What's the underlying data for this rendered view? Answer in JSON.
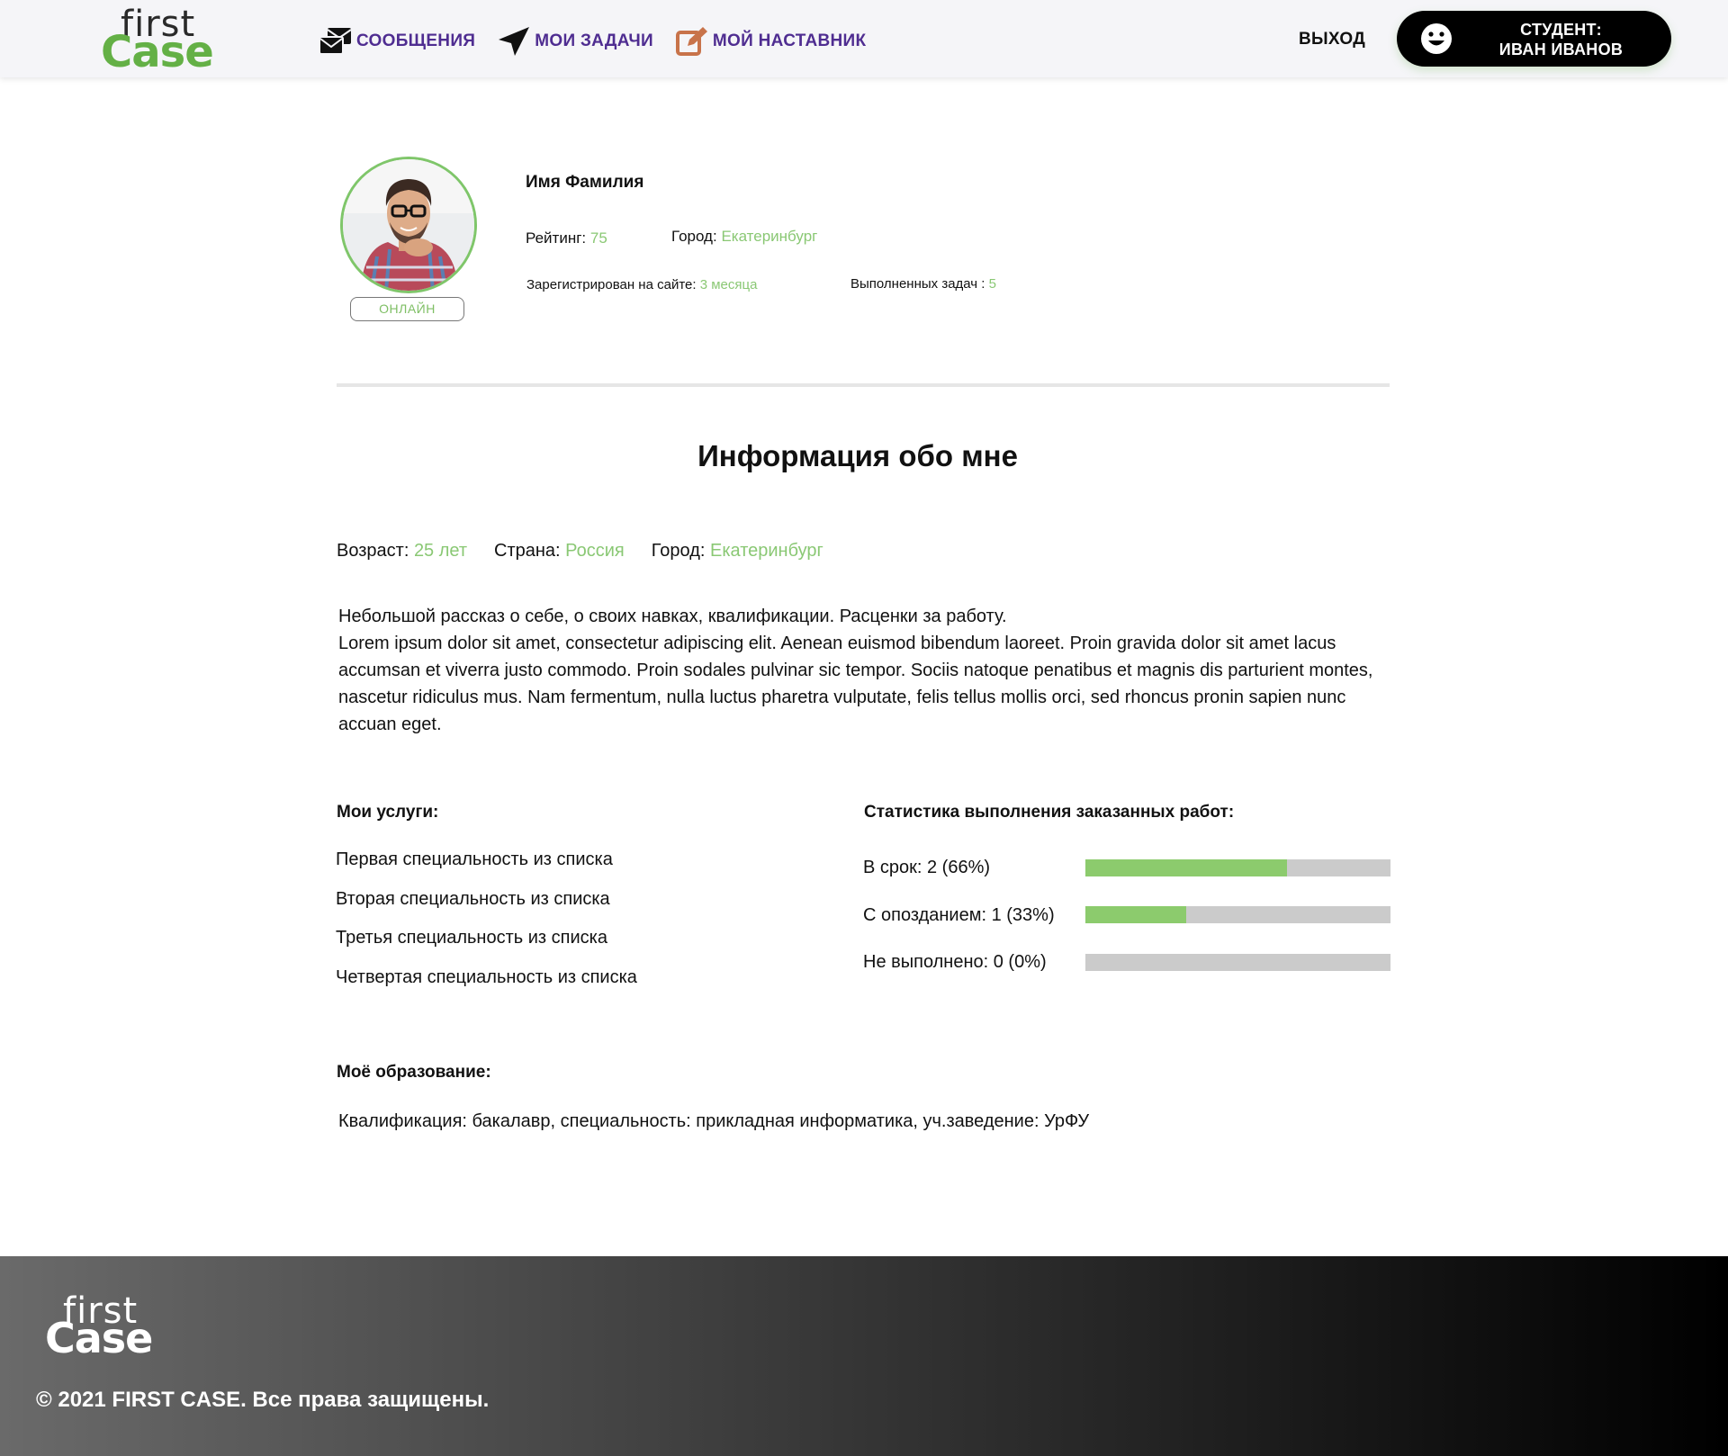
{
  "header": {
    "logo": {
      "line1": "first",
      "line2": "Case"
    },
    "nav": [
      {
        "label": "СООБЩЕНИЯ",
        "icon": "messages-icon"
      },
      {
        "label": "МОИ ЗАДАЧИ",
        "icon": "send-arrow-icon"
      },
      {
        "label": "МОЙ НАСТАВНИК",
        "icon": "edit-icon"
      }
    ],
    "logout": "ВЫХОД",
    "user": {
      "role": "СТУДЕНТ:",
      "name": "ИВАН ИВАНОВ",
      "icon": "smiley-icon"
    }
  },
  "profile": {
    "status": "ОНЛАЙН",
    "name": "Имя Фамилия",
    "rating_label": "Рейтинг:",
    "rating_value": "75",
    "city_label": "Город:",
    "city_value": "Екатеринбург",
    "registered_label": "Зарегистрирован на сайте:",
    "registered_value": "3 месяца",
    "completed_label": "Выполненных задач :",
    "completed_value": "5"
  },
  "about": {
    "title": "Информация обо мне",
    "age_label": "Возраст:",
    "age_value": "25 лет",
    "country_label": "Страна:",
    "country_value": "Россия",
    "city_label": "Город:",
    "city_value": "Екатеринбург",
    "text_line1": "Небольшой рассказ о себе, о своих навках, квалификации. Расценки за работу.",
    "text_line2": "Lorem ipsum dolor sit amet, consectetur adipiscing elit. Aenean euismod bibendum laoreet. Proin gravida dolor sit amet lacus accumsan et viverra justo commodo. Proin sodales pulvinar sic tempor. Sociis natoque penatibus et magnis dis parturient montes, nascetur ridiculus mus. Nam fermentum, nulla luctus pharetra vulputate, felis tellus mollis orci, sed rhoncus pronin sapien nunc accuan eget."
  },
  "services": {
    "title": "Мои услуги:",
    "items": [
      "Первая специальность из списка",
      "Вторая специальность из списка",
      "Третья специальность из списка",
      "Четвертая специальность из списка"
    ]
  },
  "stats": {
    "title": "Статистика выполнения заказанных работ:",
    "items": [
      {
        "label": "В срок: 2 (66%)",
        "fraction": 0.66
      },
      {
        "label": "С опозданием: 1 (33%)",
        "fraction": 0.33
      },
      {
        "label": "Не выполнено: 0 (0%)",
        "fraction": 0
      }
    ],
    "colors": {
      "fill": "#8ccb6d",
      "track": "#cbcbcb"
    }
  },
  "education": {
    "title": "Моё образование:",
    "text": "Квалификация: бакалавр, специальность: прикладная информатика, уч.заведение: УрФУ"
  },
  "footer": {
    "logo": {
      "line1": "first",
      "line2": "Case"
    },
    "copyright": "© 2021 FIRST CASE. Все права защищены."
  },
  "colors": {
    "accent": "#64b046",
    "nav": "#4f2d91",
    "value": "#8ac874"
  }
}
